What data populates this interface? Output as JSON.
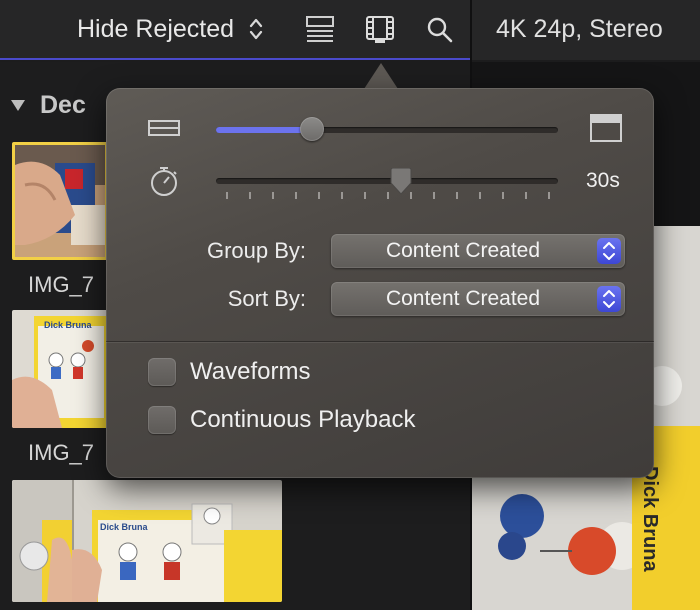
{
  "toolbar": {
    "filter_label": "Hide Rejected",
    "icons": [
      "filter-updown-icon",
      "list-view-icon",
      "filmstrip-icon",
      "search-icon"
    ]
  },
  "viewer": {
    "format_label": "4K 24p, Stereo"
  },
  "browser": {
    "event_name": "Dec",
    "clips": [
      {
        "label": "IMG_7"
      },
      {
        "label": "IMG_7"
      }
    ]
  },
  "popover": {
    "clip_height_slider": {
      "value": 0.28
    },
    "duration_slider": {
      "value": 0.54,
      "value_label": "30s"
    },
    "group_by": {
      "label": "Group By:",
      "value": "Content Created"
    },
    "sort_by": {
      "label": "Sort By:",
      "value": "Content Created"
    },
    "waveforms": {
      "label": "Waveforms",
      "checked": false
    },
    "continuous_playback": {
      "label": "Continuous Playback",
      "checked": false
    }
  },
  "colors": {
    "accent": "#6c73ee",
    "selection": "#f2d046",
    "background": "#1c1c1d"
  },
  "media": {
    "thumb1_brand_text": "Dick Bruna",
    "thumb2_brand_text": "Dick Bruna",
    "viewer_brand_text": "Dick Bruna"
  }
}
